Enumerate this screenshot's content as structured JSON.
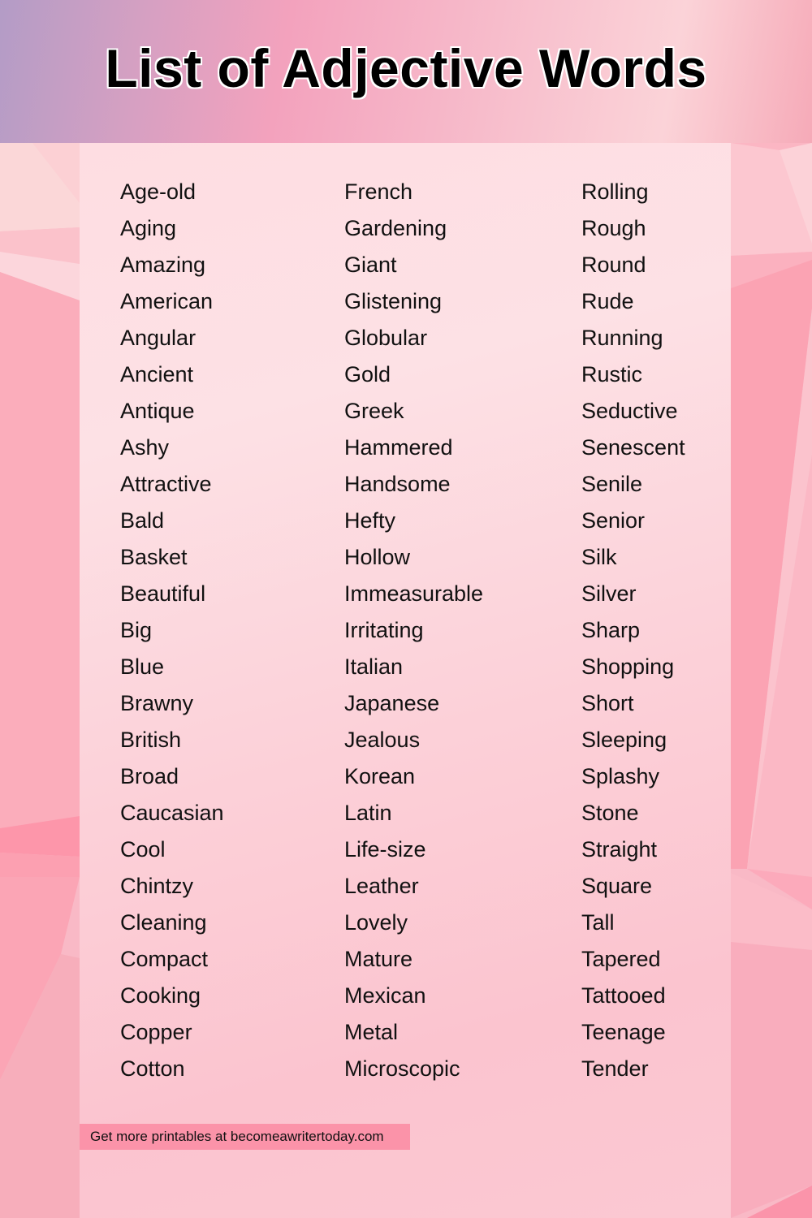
{
  "header": {
    "title": "List of Adjective Words"
  },
  "columns": [
    {
      "words": [
        "Age-old",
        "Aging",
        "Amazing",
        "American",
        "Angular",
        "Ancient",
        "Antique",
        "Ashy",
        "Attractive",
        "Bald",
        "Basket",
        "Beautiful",
        "Big",
        "Blue",
        "Brawny",
        "British",
        "Broad",
        "Caucasian",
        "Cool",
        "Chintzy",
        "Cleaning",
        "Compact",
        "Cooking",
        "Copper",
        "Cotton"
      ]
    },
    {
      "words": [
        "French",
        "Gardening",
        "Giant",
        "Glistening",
        "Globular",
        "Gold",
        "Greek",
        "Hammered",
        "Handsome",
        "Hefty",
        "Hollow",
        "Immeasurable",
        "Irritating",
        "Italian",
        "Japanese",
        "Jealous",
        "Korean",
        "Latin",
        "Life-size",
        "Leather",
        "Lovely",
        "Mature",
        "Mexican",
        "Metal",
        "Microscopic"
      ]
    },
    {
      "words": [
        "Rolling",
        "Rough",
        "Round",
        "Rude",
        "Running",
        "Rustic",
        "Seductive",
        "Senescent",
        "Senile",
        "Senior",
        "Silk",
        "Silver",
        "Sharp",
        "Shopping",
        "Short",
        "Sleeping",
        "Splashy",
        "Stone",
        "Straight",
        "Square",
        "Tall",
        "Tapered",
        "Tattooed",
        "Teenage",
        "Tender"
      ]
    }
  ],
  "footer": {
    "promo_text": "Get more printables at becomeawritertoday.com"
  },
  "colors": {
    "banner": "#fb93a9",
    "text": "#111111"
  }
}
